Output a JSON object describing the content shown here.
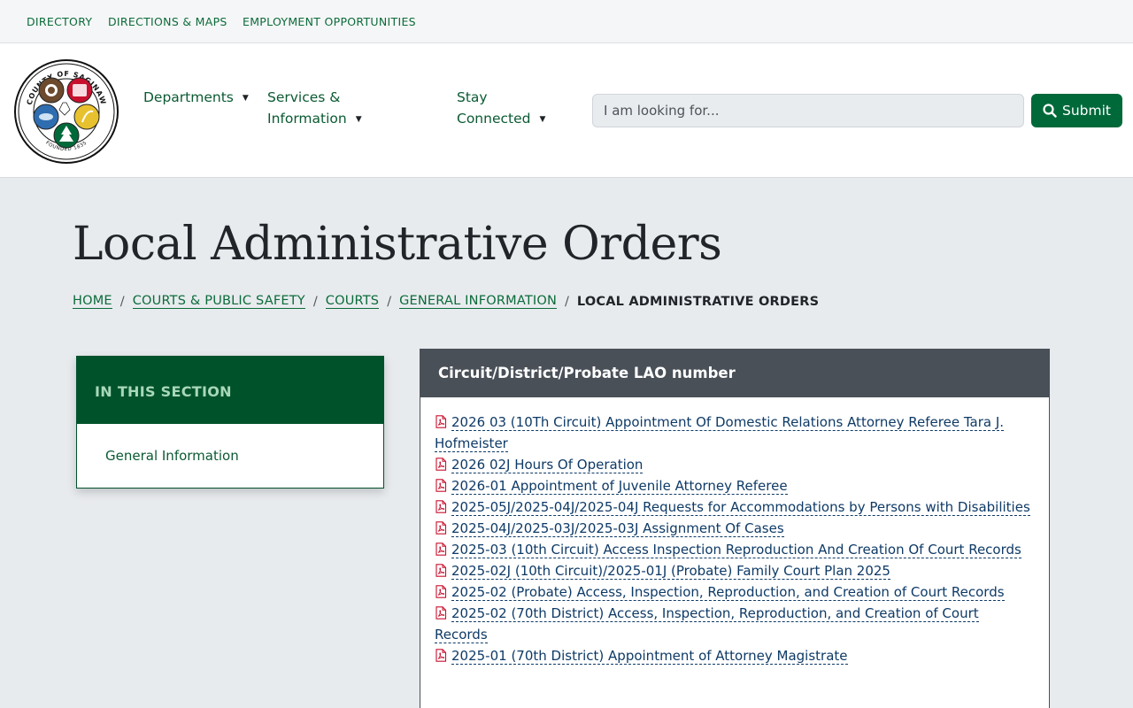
{
  "utility_nav": [
    "Directory",
    "Directions & Maps",
    "Employment Opportunities"
  ],
  "logo": {
    "top_text": "COUNTY OF SAGINAW",
    "bottom_text": "FOUNDED 1835"
  },
  "main_nav": {
    "departments": "Departments",
    "services_line1": "Services &",
    "services_line2": "Information",
    "stay_line1": "Stay",
    "stay_line2": "Connected"
  },
  "search": {
    "placeholder": "I am looking for...",
    "submit_label": "Submit"
  },
  "page": {
    "title": "Local Administrative Orders"
  },
  "breadcrumb": [
    "Home",
    "Courts & Public Safety",
    "Courts",
    "General Information",
    "Local Administrative Orders"
  ],
  "sidebar": {
    "heading": "IN THIS SECTION",
    "link": "General Information"
  },
  "panel": {
    "heading": "Circuit/District/Probate LAO number",
    "documents": [
      "2026 03 (10Th Circuit) Appointment Of Domestic Relations Attorney Referee Tara J. Hofmeister",
      "2026 02J Hours Of Operation",
      "2026-01 Appointment of Juvenile Attorney Referee",
      "2025-05J/2025-04J/2025-04J Requests for Accommodations by Persons with Disabilities",
      "2025-04J/2025-03J/2025-03J Assignment Of Cases",
      "2025-03 (10th Circuit) Access Inspection Reproduction And Creation Of Court Records",
      "2025-02J (10th Circuit)/2025-01J (Probate) Family Court Plan 2025",
      "2025-02 (Probate) Access, Inspection, Reproduction, and Creation of Court Records",
      "2025-02 (70th District) Access, Inspection, Reproduction, and Creation of Court Records",
      "2025-01 (70th District) Appointment of Attorney Magistrate"
    ]
  },
  "colors": {
    "brand_green": "#00693a",
    "dark_green": "#00522b",
    "panel_header": "#4a5058",
    "link_blue": "#0e3a66",
    "pdf_red": "#c8102e"
  },
  "icons": {
    "search_button": "search-icon",
    "document": "pdf-file-icon",
    "dropdown": "caret-down-icon"
  }
}
